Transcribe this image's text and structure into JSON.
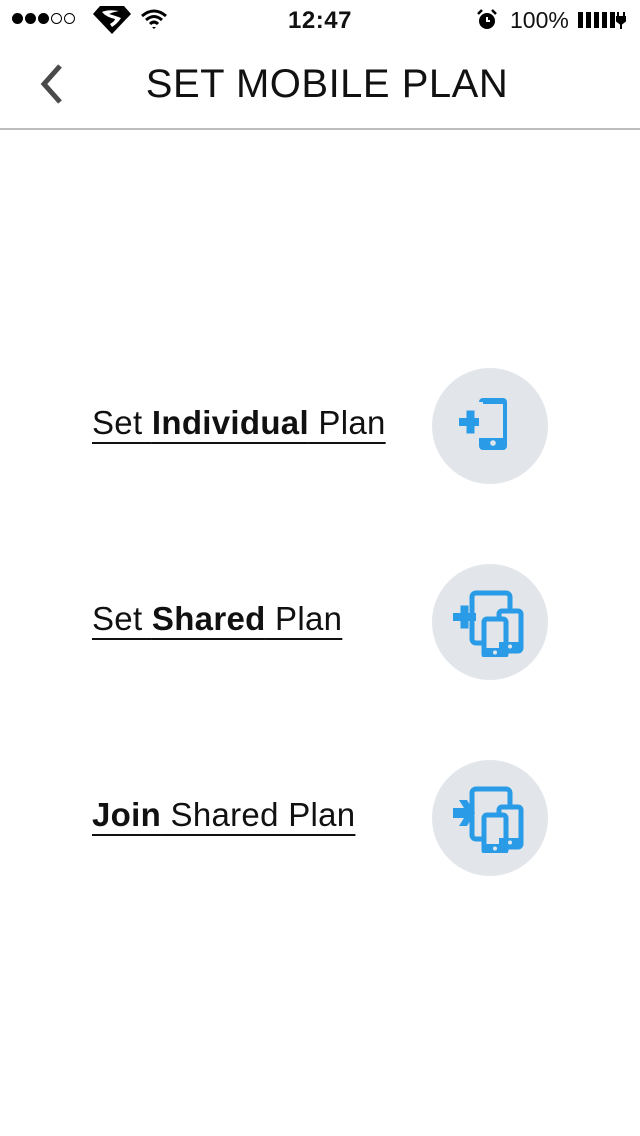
{
  "status_bar": {
    "signal_bars_filled": 3,
    "signal_bars_total": 5,
    "carrier_icon": "superman-logo-icon",
    "wifi_icon": "wifi-icon",
    "time": "12:47",
    "alarm_icon": "alarm-clock-icon",
    "battery_percent": "100%",
    "battery_icon": "battery-charging-icon"
  },
  "nav": {
    "back_icon": "chevron-left-icon",
    "title": "SET MOBILE PLAN"
  },
  "options": [
    {
      "prefix": "Set ",
      "bold": "Individual",
      "suffix": " Plan",
      "icon": "add-phone-icon"
    },
    {
      "prefix": "Set ",
      "bold": "Shared",
      "suffix": " Plan",
      "icon": "add-multiple-devices-icon"
    },
    {
      "prefix": "",
      "bold": "Join",
      "suffix": " Shared Plan",
      "icon": "join-multiple-devices-icon"
    }
  ],
  "colors": {
    "accent": "#2a9be6",
    "icon_circle_bg": "#e2e6ea"
  }
}
